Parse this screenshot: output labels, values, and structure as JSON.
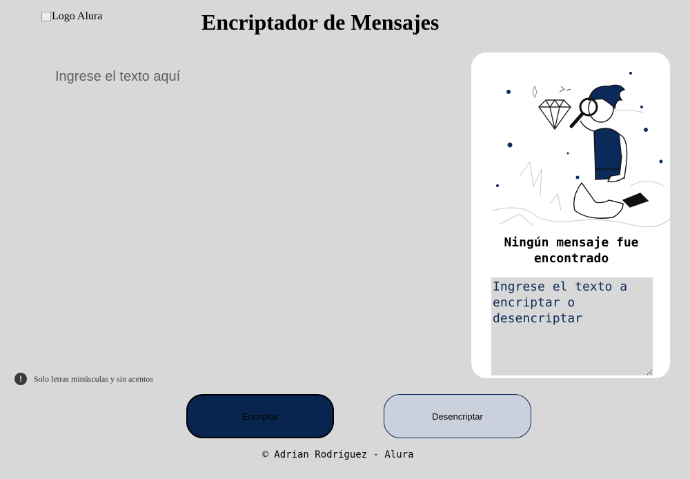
{
  "header": {
    "logo_alt": "Logo Alura",
    "title": "Encriptador de Mensajes"
  },
  "input": {
    "placeholder": "Ingrese el texto aquí",
    "value": ""
  },
  "result_panel": {
    "illustration_icon": "person-with-magnifying-glass-illustration",
    "empty_message": "Ningún mensaje fue encontrado",
    "output_placeholder": "Ingrese el texto a encriptar o desencriptar",
    "output_value": ""
  },
  "hint": {
    "icon": "info-circle-icon",
    "text": "Solo letras minúsculas y sin acentos"
  },
  "buttons": {
    "encrypt_label": "Encriptar",
    "decrypt_label": "Desencriptar"
  },
  "footer": {
    "text": "© Adrian Rodriguez - Alura"
  },
  "colors": {
    "background": "#d8d8d8",
    "primary_dark": "#08254f",
    "secondary_light": "#cbd1dc",
    "panel": "#ffffff"
  }
}
